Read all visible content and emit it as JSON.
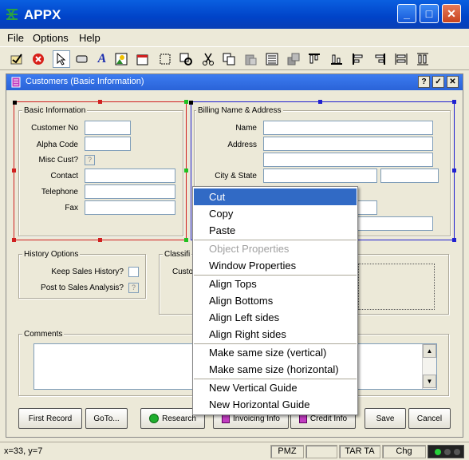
{
  "app": {
    "title": "APPX"
  },
  "menu": [
    "File",
    "Options",
    "Help"
  ],
  "toolbar": {
    "icons": [
      "new-form-icon",
      "cancel-icon",
      "pointer-icon",
      "button-tool-icon",
      "text-tool-icon",
      "image-tool-icon",
      "date-tool-icon",
      "box-tool-icon",
      "properties-icon",
      "cut-icon",
      "copy-icon",
      "paste-icon",
      "list-icon",
      "layers-icon",
      "align-top-icon",
      "align-bottom-icon",
      "align-left-icon",
      "align-right-icon",
      "same-width-icon",
      "same-height-icon"
    ]
  },
  "window": {
    "title": "Customers (Basic Information)",
    "buttons": [
      "?",
      "✓",
      "✕"
    ]
  },
  "basic_info": {
    "title": "Basic Information",
    "fields": [
      "Customer No",
      "Alpha Code",
      "Misc Cust?",
      "Contact",
      "Telephone",
      "Fax"
    ]
  },
  "billing": {
    "title": "Billing Name & Address",
    "fields": [
      "Name",
      "Address",
      "City & State"
    ]
  },
  "history": {
    "title": "History Options",
    "fields": [
      "Keep Sales History?",
      "Post to Sales Analysis?"
    ]
  },
  "classif": {
    "title": "Classifi",
    "label": "Custo"
  },
  "comments": {
    "title": "Comments"
  },
  "buttons": {
    "first_record": "First Record",
    "goto": "GoTo...",
    "research": "Research",
    "invoicing": "Invoicing Info",
    "credit": "Credit Info",
    "save": "Save",
    "cancel": "Cancel"
  },
  "status": {
    "coords": "x=33, y=7",
    "pmz": "PMZ",
    "tarta": "TAR TA",
    "chg": "Chg"
  },
  "context_menu": [
    {
      "label": "Cut",
      "state": "selected"
    },
    {
      "label": "Copy",
      "state": "normal"
    },
    {
      "label": "Paste",
      "state": "normal"
    },
    {
      "label": "Object Properties",
      "state": "disabled"
    },
    {
      "label": "Window Properties",
      "state": "normal"
    },
    {
      "label": "Align Tops",
      "state": "normal"
    },
    {
      "label": "Align Bottoms",
      "state": "normal"
    },
    {
      "label": "Align Left sides",
      "state": "normal"
    },
    {
      "label": "Align Right sides",
      "state": "normal"
    },
    {
      "label": "Make same size (vertical)",
      "state": "normal"
    },
    {
      "label": "Make same size (horizontal)",
      "state": "normal"
    },
    {
      "label": "New Vertical Guide",
      "state": "normal"
    },
    {
      "label": "New Horizontal Guide",
      "state": "normal"
    }
  ],
  "colors": {
    "titlebar": "#0a5fe0",
    "selection": "#316ac5",
    "handle_red": "#d02020",
    "handle_blue": "#2020d0"
  }
}
